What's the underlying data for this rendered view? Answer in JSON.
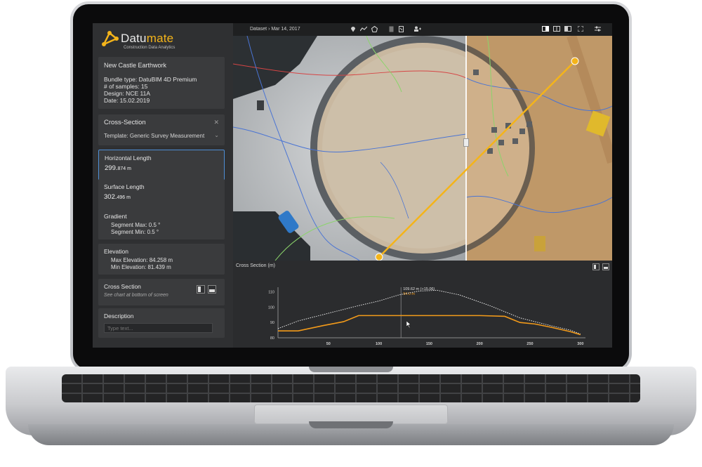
{
  "brand": {
    "name_prefix": "Datu",
    "name_suffix": "mate",
    "tagline": "Construction Data Analytics",
    "accent_color": "#f4b41a"
  },
  "project": {
    "name": "New Castle Earthwork",
    "bundle": "Bundle type: DatuBIM 4D Premium",
    "samples": "# of samples: 15",
    "design": "Design: NCE 11A",
    "date": "Date: 15.02.2019"
  },
  "cross_section": {
    "title": "Cross-Section",
    "close": "✕",
    "template": "Template: Generic Survey Measurement",
    "caret": "⌄"
  },
  "measurements": {
    "horizontal": {
      "label": "Horizontal Length",
      "value_main": "299.",
      "value_dec": "874 m"
    },
    "surface": {
      "label": "Surface Length",
      "value_main": "302.",
      "value_dec": "496 m"
    },
    "gradient": {
      "label": "Gradient",
      "max": "Segment Max: 0.5 °",
      "min": "Segment Min: 0.5 °"
    },
    "elevation": {
      "label": "Elevation",
      "max": "Max Elevation: 84.258 m",
      "min": "Min Elevation: 81.439 m"
    },
    "cross_section": {
      "label": "Cross Section",
      "note": "See chart at bottom of screen"
    },
    "description": {
      "label": "Description",
      "placeholder": "Type text..."
    }
  },
  "toolbar": {
    "breadcrumb": "Dataset › Mar 14, 2017",
    "icons": [
      "pin-icon",
      "line-tool-icon",
      "polygon-icon",
      "document-icon",
      "report-icon",
      "users-icon",
      "layout-icon",
      "split-view-icon",
      "compare-icon",
      "fullscreen-icon",
      "settings-icon"
    ]
  },
  "chart_panel": {
    "title": "Cross Section (m)"
  },
  "chart_data": {
    "type": "line",
    "x_ticks": [
      50,
      100,
      150,
      200,
      250,
      300
    ],
    "y_ticks": [
      80,
      90,
      100,
      110
    ],
    "xlim": [
      0,
      305
    ],
    "ylim": [
      80,
      113
    ],
    "tooltip": {
      "line1": "109.62 m (+15.06)",
      "line2": "94.0 m",
      "x": 122
    },
    "series": [
      {
        "color": "#e8e8e8",
        "style": "dotted",
        "x": [
          0,
          20,
          50,
          80,
          100,
          120,
          140,
          158,
          180,
          210,
          240,
          270,
          290,
          300
        ],
        "y": [
          86,
          91,
          96,
          101,
          104,
          108,
          110.5,
          111,
          108,
          101,
          93,
          88,
          85,
          82.5
        ]
      },
      {
        "color": "#f29a1a",
        "style": "solid",
        "x": [
          0,
          20,
          45,
          65,
          80,
          100,
          150,
          200,
          225,
          240,
          255,
          270,
          290,
          300
        ],
        "y": [
          84.5,
          84.5,
          88,
          90.5,
          94.5,
          94.5,
          94.5,
          94.5,
          94,
          90,
          89,
          87,
          84,
          82
        ]
      }
    ]
  }
}
